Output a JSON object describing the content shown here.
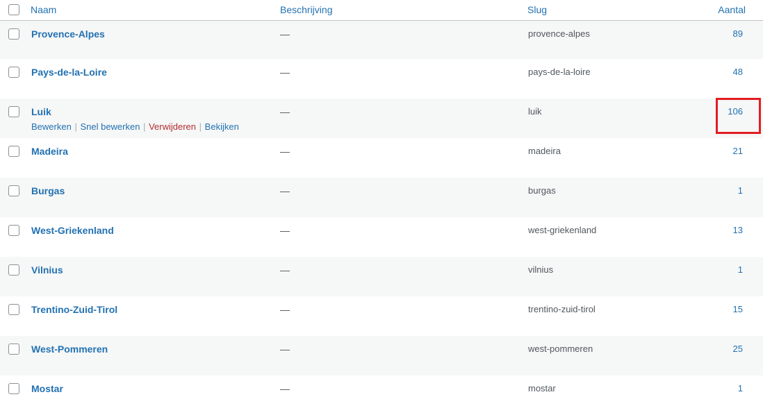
{
  "table": {
    "headers": {
      "name": "Naam",
      "description": "Beschrijving",
      "slug": "Slug",
      "count": "Aantal"
    },
    "rows": [
      {
        "name": "Provence-Alpes",
        "description": "—",
        "slug": "provence-alpes",
        "count": "89"
      },
      {
        "name": "Pays-de-la-Loire",
        "description": "—",
        "slug": "pays-de-la-loire",
        "count": "48"
      },
      {
        "name": "Luik",
        "description": "—",
        "slug": "luik",
        "count": "106"
      },
      {
        "name": "Madeira",
        "description": "—",
        "slug": "madeira",
        "count": "21"
      },
      {
        "name": "Burgas",
        "description": "—",
        "slug": "burgas",
        "count": "1"
      },
      {
        "name": "West-Griekenland",
        "description": "—",
        "slug": "west-griekenland",
        "count": "13"
      },
      {
        "name": "Vilnius",
        "description": "—",
        "slug": "vilnius",
        "count": "1"
      },
      {
        "name": "Trentino-Zuid-Tirol",
        "description": "—",
        "slug": "trentino-zuid-tirol",
        "count": "15"
      },
      {
        "name": "West-Pommeren",
        "description": "—",
        "slug": "west-pommeren",
        "count": "25"
      },
      {
        "name": "Mostar",
        "description": "—",
        "slug": "mostar",
        "count": "1"
      }
    ],
    "row_actions": {
      "edit": "Bewerken",
      "quick_edit": "Snel bewerken",
      "delete": "Verwijderen",
      "view": "Bekijken",
      "separator": "|"
    }
  },
  "colors": {
    "link": "#2271b1",
    "delete": "#b32d2e",
    "highlight": "#e31c22",
    "alt_row": "#f6f7f7"
  }
}
